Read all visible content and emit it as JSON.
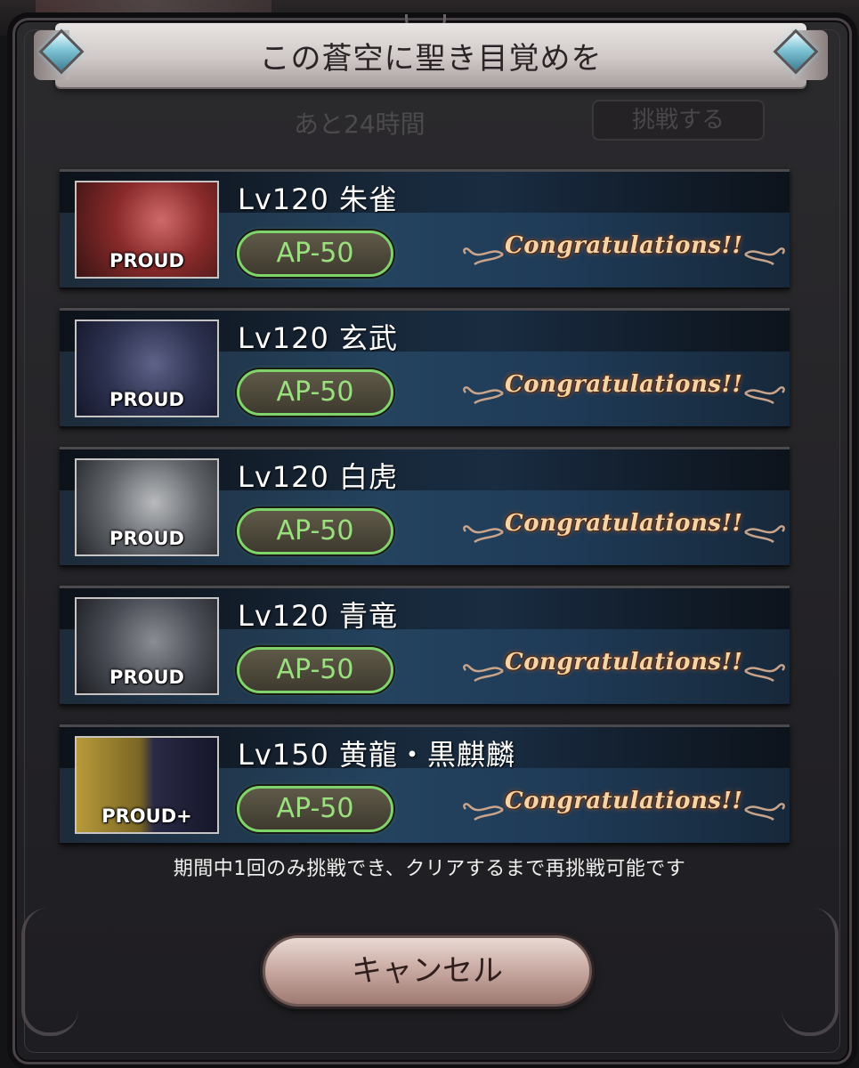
{
  "dialog": {
    "title": "この蒼空に聖き目覚めを",
    "background": {
      "ghost_timer": "あと24時間",
      "ghost_button": "挑戦する"
    },
    "quests": [
      {
        "level_name": "Lv120 朱雀",
        "tag": "PROUD",
        "ap": "AP-50",
        "status": "Congratulations!!"
      },
      {
        "level_name": "Lv120 玄武",
        "tag": "PROUD",
        "ap": "AP-50",
        "status": "Congratulations!!"
      },
      {
        "level_name": "Lv120 白虎",
        "tag": "PROUD",
        "ap": "AP-50",
        "status": "Congratulations!!"
      },
      {
        "level_name": "Lv120 青竜",
        "tag": "PROUD",
        "ap": "AP-50",
        "status": "Congratulations!!"
      },
      {
        "level_name": "Lv150 黄龍・黒麒麟",
        "tag": "PROUD+",
        "ap": "AP-50",
        "status": "Congratulations!!"
      }
    ],
    "note": "期間中1回のみ挑戦でき、クリアするまで再挑戦可能です",
    "cancel_label": "キャンセル"
  },
  "colors": {
    "ap_border": "#7fd46a",
    "ap_text": "#9be07f",
    "congrats_text": "#f3d5a7",
    "card_blue": "#24435f"
  },
  "icons": [
    "gem-left-icon",
    "gem-right-icon",
    "flourish-icon"
  ]
}
